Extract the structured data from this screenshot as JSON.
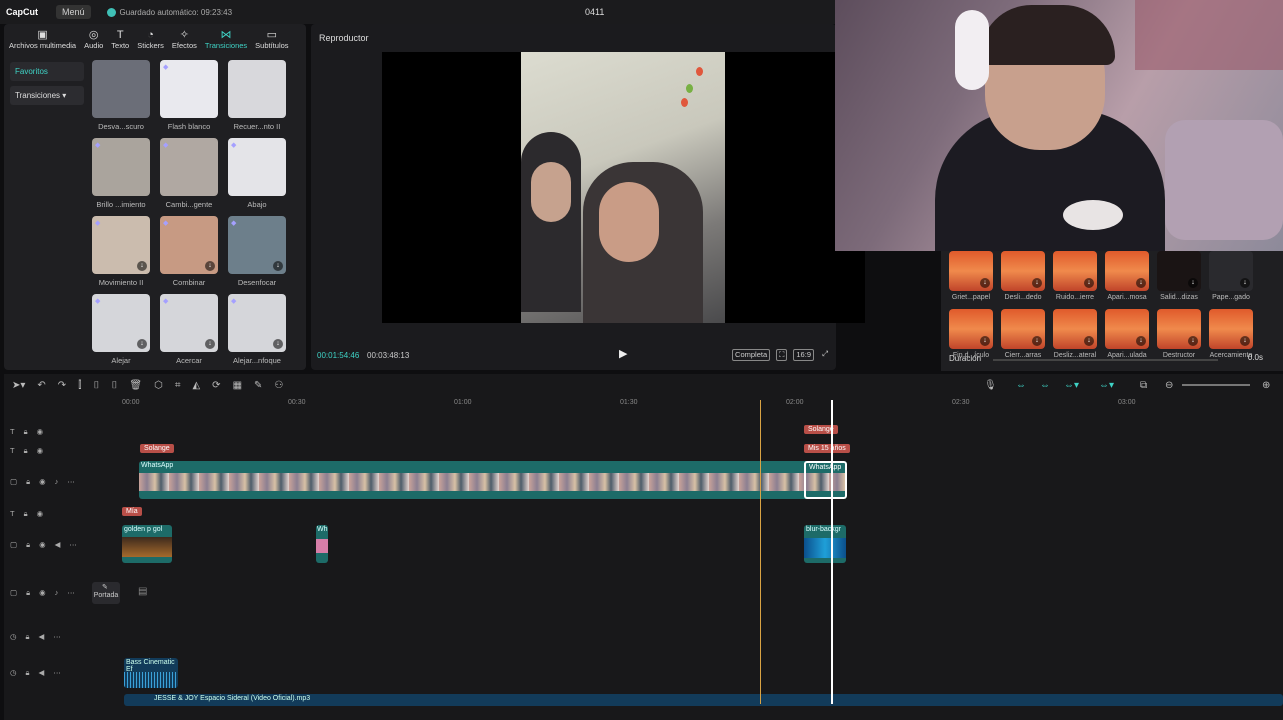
{
  "app": {
    "logo": "CapCut",
    "menu": "Menú",
    "autosave": "Guardado automático: 09:23:43",
    "project": "0411"
  },
  "toolbar": [
    {
      "icon": "media-icon",
      "label": "Archivos multimedia"
    },
    {
      "icon": "audio-icon",
      "label": "Audio"
    },
    {
      "icon": "text-icon",
      "label": "Texto"
    },
    {
      "icon": "stickers-icon",
      "label": "Stickers"
    },
    {
      "icon": "effects-icon",
      "label": "Efectos"
    },
    {
      "icon": "transitions-icon",
      "label": "Transiciones",
      "active": true
    },
    {
      "icon": "subtitles-icon",
      "label": "Subtítulos"
    }
  ],
  "categories": {
    "favorites": "Favoritos",
    "transitions": "Transiciones"
  },
  "transitions": [
    {
      "label": "Desva...scuro",
      "bg": "#6b6e78"
    },
    {
      "label": "Flash blanco",
      "bg": "#e9e9ee"
    },
    {
      "label": "Recuer...nto II",
      "bg": "#d8d8dc"
    },
    {
      "label": "Brillo ...imiento",
      "bg": "#aaa49d"
    },
    {
      "label": "Cambi...gente",
      "bg": "#b0a8a2"
    },
    {
      "label": "Abajo",
      "bg": "#e4e4e8"
    },
    {
      "label": "Movimiento II",
      "bg": "#cbbcae"
    },
    {
      "label": "Combinar",
      "bg": "#c79a83"
    },
    {
      "label": "Desenfocar",
      "bg": "#6d7f8b"
    },
    {
      "label": "Alejar",
      "bg": "#d5d6da"
    },
    {
      "label": "Acercar",
      "bg": "#d5d6da"
    },
    {
      "label": "Alejar...nfoque",
      "bg": "#d5d6da"
    }
  ],
  "player": {
    "title": "Reproductor",
    "current": "00:01:54:46",
    "total": "00:03:48:13",
    "full": "Completa",
    "ratio": "16:9"
  },
  "effects": [
    "Griet...papel",
    "Desli...dedo",
    "Ruido...ierre",
    "Apari...mosa",
    "Salid...dizas",
    "Pape...gado",
    "Fin d...ículo",
    "Cierr...arras",
    "Desliz...ateral",
    "Apari...ulada",
    "Destructor",
    "Acercamiento"
  ],
  "duration": {
    "label": "Duración",
    "value": "0.0s"
  },
  "ruler": [
    "00:00",
    "00:30",
    "01:00",
    "01:30",
    "02:00",
    "02:30",
    "03:00"
  ],
  "tags": {
    "solange1": "Solange",
    "solange2": "Solange",
    "age": "Mis 15 años",
    "mia": "Mía"
  },
  "clips": {
    "whatsapp": "WhatsApp",
    "golden": "golden p",
    "golden2": "gol",
    "wh": "Wh",
    "blur": "blur-backgr",
    "bass": "Bass Cinematic Ef",
    "song": "JESSE & JOY  Espacio Sideral (Video Oficial).mp3"
  },
  "cover": "Portada"
}
